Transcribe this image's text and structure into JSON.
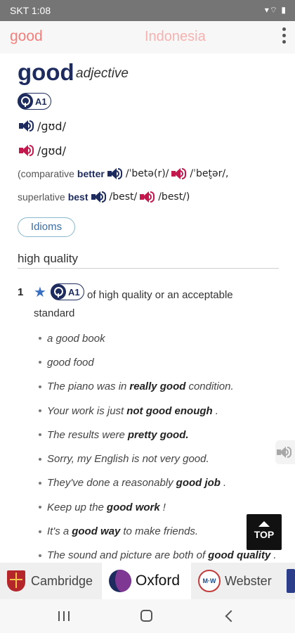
{
  "status_bar": {
    "carrier_time": "SKT 1:08",
    "icons_text": "▾⌔ ▮"
  },
  "header": {
    "word": "good",
    "language": "Indonesia"
  },
  "entry": {
    "headword": "good",
    "pos": "adjective",
    "level": "A1",
    "pron_uk": "/ɡʊd/",
    "pron_us": "/ɡʊd/",
    "forms": {
      "open": "(comparative",
      "comparative": "better",
      "comparative_uk": "/ˈbetə(r)/",
      "comparative_us": "/ˈbet̬ər/,",
      "sup_label": "superlative",
      "superlative": "best",
      "superlative_uk": "/best/",
      "superlative_us": "/best/)"
    },
    "idioms_label": "Idioms",
    "section_title": "high quality",
    "sense": {
      "number": "1",
      "level": "A1",
      "definition": "of high quality or an acceptable standard"
    },
    "examples": [
      {
        "pre": "a good book",
        "bold": "",
        "post": ""
      },
      {
        "pre": "good food",
        "bold": "",
        "post": ""
      },
      {
        "pre": "The piano was in",
        "bold": "really good",
        "post": "condition."
      },
      {
        "pre": "Your work is just",
        "bold": "not good enough",
        "post": "."
      },
      {
        "pre": "The results were",
        "bold": "pretty good.",
        "post": ""
      },
      {
        "pre": "Sorry, my English is not very good.",
        "bold": "",
        "post": ""
      },
      {
        "pre": "They've done a reasonably",
        "bold": "good job",
        "post": "."
      },
      {
        "pre": "Keep up the",
        "bold": "good work",
        "post": "!"
      },
      {
        "pre": "It's a",
        "bold": "good way",
        "post": "to make friends."
      },
      {
        "pre": "The sound and picture are both of",
        "bold": "good quality",
        "post": "."
      }
    ]
  },
  "top_button": {
    "label": "TOP"
  },
  "dictionaries": [
    {
      "name": "Cambridge"
    },
    {
      "name": "Oxford"
    },
    {
      "name": "Webster"
    }
  ],
  "colors": {
    "accent": "#f37f7b",
    "navy": "#1d2b5e",
    "us_red": "#c2184d",
    "star_blue": "#3a70c2"
  }
}
